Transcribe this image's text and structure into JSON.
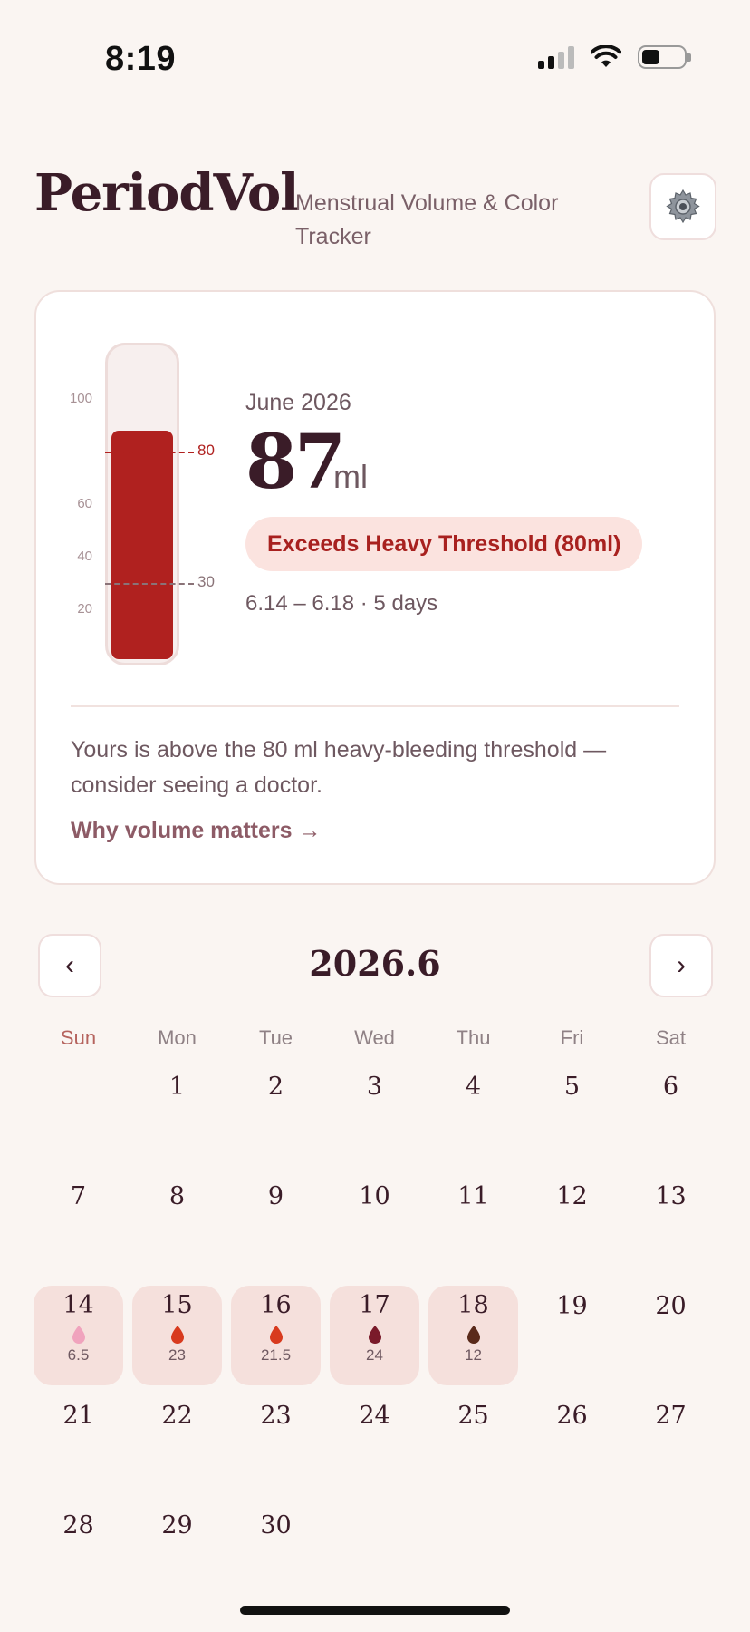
{
  "status_bar": {
    "time": "8:19"
  },
  "header": {
    "title": "PeriodVol",
    "subtitle": "Menstrual Volume & Color Tracker"
  },
  "summary": {
    "month": "June 2026",
    "volume": "87",
    "unit": "ml",
    "badge": "Exceeds Heavy Threshold (80ml)",
    "range": "6.14 – 6.18 · 5 days",
    "advice": "Yours is above the 80 ml heavy-bleeding threshold — consider seeing a doctor.",
    "link": "Why volume matters →",
    "gauge": {
      "ticks": [
        "100",
        "60",
        "40",
        "20"
      ],
      "markers": [
        {
          "label": "80",
          "value": 80,
          "color": "#b0211f"
        },
        {
          "label": "30",
          "value": 30,
          "color": "#8a7378"
        }
      ],
      "fill_value": 87,
      "max_value": 120
    }
  },
  "calendar": {
    "title": "2026.6",
    "prev": "‹",
    "next": "›",
    "weekdays": [
      "Sun",
      "Mon",
      "Tue",
      "Wed",
      "Thu",
      "Fri",
      "Sat"
    ],
    "first_weekday_index": 1,
    "days_in_month": 30,
    "period_days": [
      {
        "day": 14,
        "volume": "6.5",
        "color": "#f0a3bd"
      },
      {
        "day": 15,
        "volume": "23",
        "color": "#d83a1e"
      },
      {
        "day": 16,
        "volume": "21.5",
        "color": "#d83a1e"
      },
      {
        "day": 17,
        "volume": "24",
        "color": "#7a1a2a"
      },
      {
        "day": 18,
        "volume": "12",
        "color": "#5a2a1a"
      }
    ]
  },
  "icons": {
    "settings": "gear-icon"
  }
}
